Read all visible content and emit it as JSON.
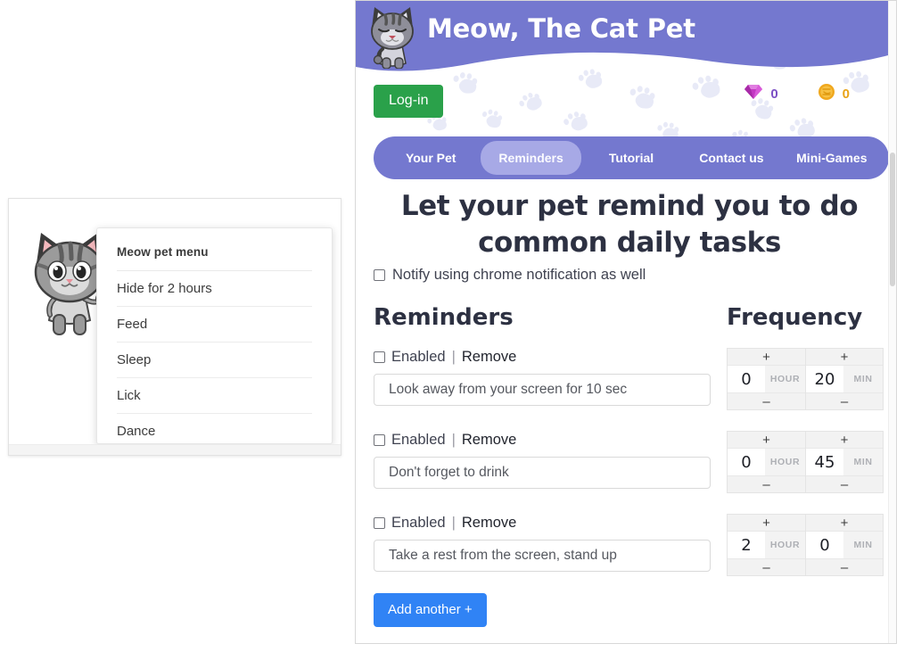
{
  "pet_panel": {
    "sprite_name": "gray-tabby-cat-sprite",
    "menu": {
      "title": "Meow pet menu",
      "items": [
        {
          "label": "Hide for 2 hours"
        },
        {
          "label": "Feed"
        },
        {
          "label": "Sleep"
        },
        {
          "label": "Lick"
        },
        {
          "label": "Dance"
        }
      ]
    }
  },
  "app": {
    "brand": {
      "title": "Meow, The Cat Pet",
      "logo_icon": "cat-logo-icon",
      "header_color": "#7478cf"
    },
    "login_button": "Log-in",
    "currencies": [
      {
        "icon": "gem-icon",
        "value": "0",
        "color": "#7b4fc4"
      },
      {
        "icon": "coin-icon",
        "value": "0",
        "color": "#e8a317"
      }
    ],
    "nav": {
      "items": [
        {
          "label": "Your Pet",
          "active": false
        },
        {
          "label": "Reminders",
          "active": true
        },
        {
          "label": "Tutorial",
          "active": false
        },
        {
          "label": "Contact us",
          "active": false
        },
        {
          "label": "Mini-Games",
          "active": false
        }
      ],
      "active_color": "#a7a9e6"
    },
    "headline": "Let your pet remind you to do common daily tasks",
    "notify": {
      "label": "Notify using chrome notification as well",
      "checked": false
    },
    "headers": {
      "reminders": "Reminders",
      "frequency": "Frequency"
    },
    "row_labels": {
      "enabled": "Enabled",
      "separator": "|",
      "remove": "Remove",
      "plus": "+",
      "minus": "–",
      "hour_unit": "HOUR",
      "min_unit": "MIN"
    },
    "reminders": [
      {
        "enabled": false,
        "text": "Look away from your screen for 10 sec",
        "hours": "0",
        "minutes": "20"
      },
      {
        "enabled": false,
        "text": "Don't forget to drink",
        "hours": "0",
        "minutes": "45"
      },
      {
        "enabled": false,
        "text": "Take a rest from the screen, stand up",
        "hours": "2",
        "minutes": "0"
      }
    ],
    "add_another_button": "Add another +"
  }
}
